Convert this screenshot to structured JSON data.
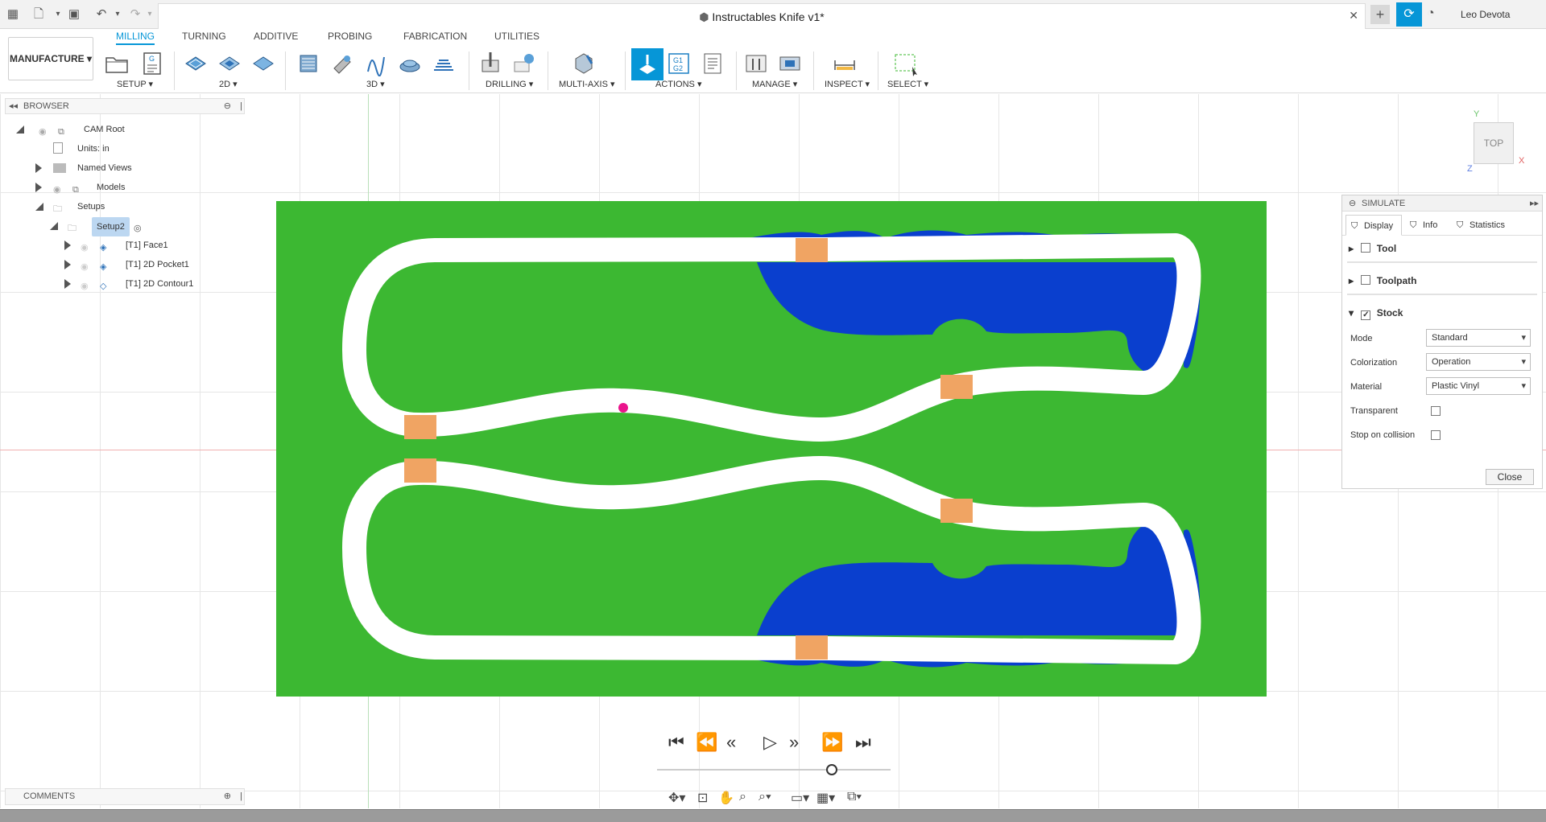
{
  "app": {
    "document_title": "Instructables Knife v1*",
    "user_name": "Leo Devota"
  },
  "toolbar": {
    "workspace_label": "MANUFACTURE",
    "tabs": [
      {
        "label": "MILLING",
        "active": true
      },
      {
        "label": "TURNING",
        "active": false
      },
      {
        "label": "ADDITIVE",
        "active": false
      },
      {
        "label": "PROBING",
        "active": false
      },
      {
        "label": "FABRICATION",
        "active": false
      },
      {
        "label": "UTILITIES",
        "active": false
      }
    ],
    "groups": {
      "setup": "SETUP",
      "two_d": "2D",
      "three_d": "3D",
      "drilling": "DRILLING",
      "multi_axis": "MULTI-AXIS",
      "actions": "ACTIONS",
      "manage": "MANAGE",
      "inspect": "INSPECT",
      "select": "SELECT"
    },
    "g1g2_label": "G1 G2"
  },
  "browser": {
    "title": "BROWSER",
    "items": [
      {
        "label": "CAM Root"
      },
      {
        "label": "Units: in"
      },
      {
        "label": "Named Views"
      },
      {
        "label": "Models"
      },
      {
        "label": "Setups"
      },
      {
        "label": "Setup2"
      },
      {
        "label": "[T1] Face1"
      },
      {
        "label": "[T1] 2D Pocket1"
      },
      {
        "label": "[T1] 2D Contour1"
      }
    ]
  },
  "comments": {
    "title": "COMMENTS"
  },
  "navcube": {
    "face": "TOP",
    "axes": {
      "x": "X",
      "y": "Y",
      "z": "Z"
    }
  },
  "simulate": {
    "title": "SIMULATE",
    "tabs": [
      {
        "label": "Display",
        "active": true
      },
      {
        "label": "Info",
        "active": false
      },
      {
        "label": "Statistics",
        "active": false
      }
    ],
    "sections": {
      "tool": {
        "label": "Tool",
        "checked": false
      },
      "toolpath": {
        "label": "Toolpath",
        "checked": false
      },
      "stock": {
        "label": "Stock",
        "checked": true
      }
    },
    "props": {
      "mode": {
        "label": "Mode",
        "value": "Standard"
      },
      "colorization": {
        "label": "Colorization",
        "value": "Operation"
      },
      "material": {
        "label": "Material",
        "value": "Plastic Vinyl"
      },
      "transparent": {
        "label": "Transparent",
        "checked": false
      },
      "stop_on_collision": {
        "label": "Stop on collision",
        "checked": false
      }
    },
    "close_label": "Close"
  },
  "colors": {
    "accent": "#0696d7",
    "stock_green": "#3cb832",
    "face_blue": "#0a3fce",
    "tab_orange": "#f0a463",
    "marker_magenta": "#ea148c"
  },
  "icons": {
    "playback": [
      "skip-to-start-icon",
      "previous-operation-icon",
      "step-back-icon",
      "play-icon",
      "step-forward-icon",
      "next-operation-icon",
      "skip-to-end-icon"
    ]
  }
}
